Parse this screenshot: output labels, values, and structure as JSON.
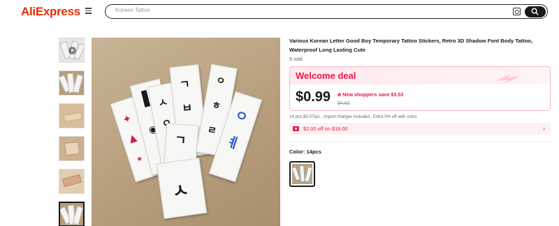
{
  "header": {
    "logo_text": "AliExpress",
    "search_placeholder": "Korean Tattoo"
  },
  "thumbnails": [
    {
      "name": "thumb-1",
      "has_video": true
    },
    {
      "name": "thumb-2"
    },
    {
      "name": "thumb-3"
    },
    {
      "name": "thumb-4"
    },
    {
      "name": "thumb-5"
    },
    {
      "name": "thumb-6",
      "selected": true
    }
  ],
  "product": {
    "title": "Various Korean Letter Good Boy Temporary Tattoo Stickers, Retro 3D Shadow Font Body Tattoo, Waterproof Long Lasting Cute",
    "sold": "9 sold",
    "deal_title": "Welcome deal",
    "price": "$0.99",
    "new_shopper_badge": "New shoppers save $3.53",
    "original_price": "$4.52",
    "fineprint": "14 pcs,$0.07/pc , Import charges included , Extra 5% off with coins",
    "coupon_text": "$2.00 off on $18.00",
    "color_label": "Color: 14pcs"
  },
  "colors": {
    "accent": "#ee1545",
    "brand_red": "#e62e04"
  }
}
